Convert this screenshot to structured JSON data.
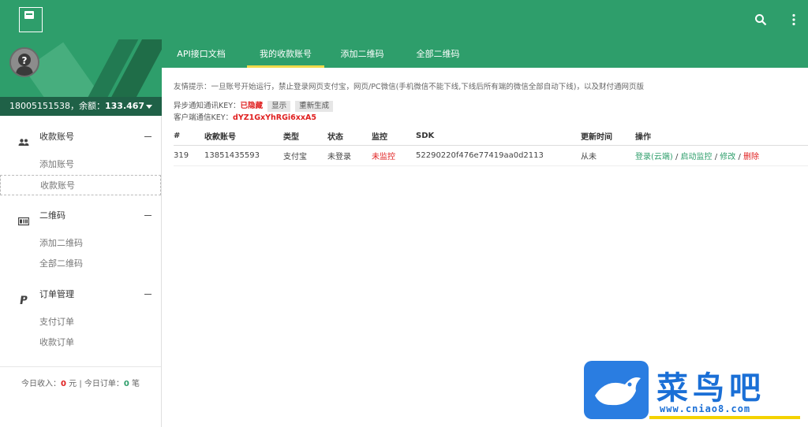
{
  "header": {
    "logo_icon": "qr-screen-icon",
    "search_icon": "search-icon",
    "more_icon": "more-vert-icon"
  },
  "profile": {
    "avatar_icon": "question-avatar-icon",
    "account": "18005151538，余额：",
    "balance": "133.467"
  },
  "sidebar": {
    "groups": [
      {
        "label": "收款账号",
        "icon": "people-icon",
        "items": [
          "添加账号",
          "收款账号"
        ]
      },
      {
        "label": "二维码",
        "icon": "id-card-icon",
        "items": [
          "添加二维码",
          "全部二维码"
        ]
      },
      {
        "label": "订单管理",
        "icon": "paypal-icon",
        "items": [
          "支付订单",
          "收款订单"
        ]
      }
    ],
    "stats": {
      "income_label": "今日收入：",
      "income_value": "0",
      "income_unit": "元",
      "sep": "|",
      "orders_label": "今日订单：",
      "orders_value": "0",
      "orders_unit": "笔"
    }
  },
  "tabs": [
    "API接口文档",
    "我的收款账号",
    "添加二维码",
    "全部二维码"
  ],
  "content": {
    "tip": "友情提示：一旦账号开始运行，禁止登录网页支付宝，网页/PC微信(手机微信不能下线,下线后所有端的微信全部自动下线)，以及财付通网页版",
    "async_key_label": "异步通知通讯KEY：",
    "async_key_value": "已隐藏",
    "btn_show": "显示",
    "btn_regen": "重新生成",
    "client_key_label": "客户端通信KEY：",
    "client_key_value": "dYZ1GxYhRGi6xxA5"
  },
  "table": {
    "headers": [
      "#",
      "收款账号",
      "类型",
      "状态",
      "监控",
      "SDK",
      "更新时间",
      "操作"
    ],
    "rows": [
      {
        "id": "319",
        "account": "13851435593",
        "type": "支付宝",
        "status": "未登录",
        "monitor": "未监控",
        "sdk": "52290220f476e77419aa0d2113",
        "updated": "从未",
        "act_login": "登录(云端)",
        "act_sep": " / ",
        "act_start": "启动监控",
        "act_edit": "修改",
        "act_delete": "删除"
      }
    ]
  },
  "watermark": {
    "text": "菜鸟吧",
    "url": "www.cniao8.com"
  },
  "colors": {
    "primary": "#2e9e6b",
    "dark": "#1f6147",
    "accent": "#f0d94a",
    "danger": "#e02020"
  }
}
